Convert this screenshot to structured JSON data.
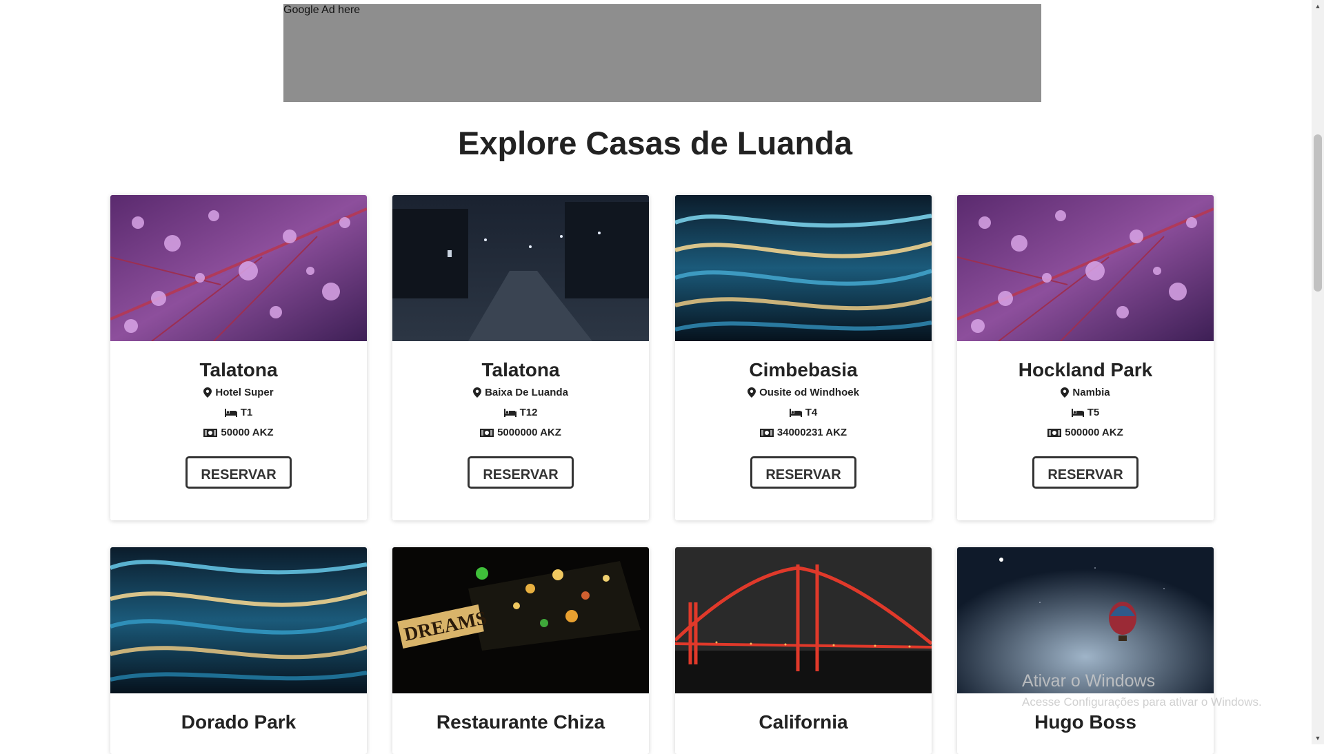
{
  "ad": {
    "label": "Google Ad here"
  },
  "page_title": "Explore Casas de Luanda",
  "cards": [
    {
      "name": "Talatona",
      "location": "Hotel Super",
      "rooms": "T1",
      "price": "50000 AKZ",
      "button": "RESERVAR",
      "image": "purple-leaf-droplets"
    },
    {
      "name": "Talatona",
      "location": "Baixa De Luanda",
      "rooms": "T12",
      "price": "5000000 AKZ",
      "button": "RESERVAR",
      "image": "dark-night-street"
    },
    {
      "name": "Cimbebasia",
      "location": "Ousite od Windhoek",
      "rooms": "T4",
      "price": "34000231 AKZ",
      "button": "RESERVAR",
      "image": "blue-waves"
    },
    {
      "name": "Hockland Park",
      "location": "Nambia",
      "rooms": "T5",
      "price": "500000 AKZ",
      "button": "RESERVAR",
      "image": "purple-leaf-droplets"
    },
    {
      "name": "Dorado Park",
      "image": "blue-waves"
    },
    {
      "name": "Restaurante Chiza",
      "image": "dreams-bottle-lights"
    },
    {
      "name": "California",
      "image": "golden-gate-bridge-night"
    },
    {
      "name": "Hugo Boss",
      "image": "hot-air-balloon-night"
    }
  ],
  "icons": {
    "location": "map-pin-icon",
    "rooms": "bed-icon",
    "price": "money-icon"
  },
  "watermark": {
    "title": "Ativar o Windows",
    "subtitle": "Acesse Configurações para ativar o Windows."
  }
}
